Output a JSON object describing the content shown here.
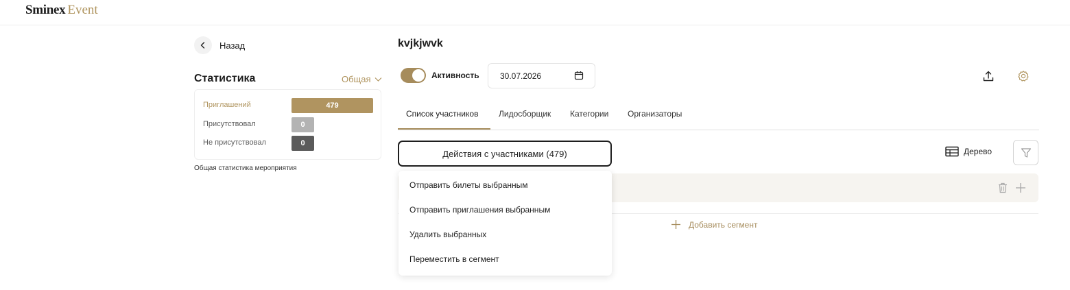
{
  "brand": {
    "name_bold": "Sminex",
    "name_light": "Event"
  },
  "back": {
    "label": "Назад"
  },
  "statistics": {
    "title": "Статистика",
    "filter": "Общая",
    "rows": [
      {
        "label": "Приглашений",
        "value": "479",
        "color": "#b09460"
      },
      {
        "label": "Присутствовал",
        "value": "0",
        "color": "#b3b3b3"
      },
      {
        "label": "Не присутствовал",
        "value": "0",
        "color": "#5b5b5b"
      }
    ],
    "caption": "Общая статистика мероприятия"
  },
  "event": {
    "title": "kvjkjwvk",
    "activity_label": "Активность",
    "activity_on": true,
    "date": "30.07.2026"
  },
  "tabs": [
    {
      "label": "Список участников",
      "active": true
    },
    {
      "label": "Лидосборщик",
      "active": false
    },
    {
      "label": "Категории",
      "active": false
    },
    {
      "label": "Организаторы",
      "active": false
    }
  ],
  "toolbar": {
    "actions_label": "Действия с участниками (479)",
    "tree_label": "Дерево"
  },
  "dropdown": {
    "items": [
      "Отправить билеты выбранным",
      "Отправить приглашения выбранным",
      "Удалить выбранных",
      "Переместить в сегмент"
    ]
  },
  "segments": {
    "add_label": "Добавить сегмент"
  },
  "colors": {
    "accent": "#a68c5c",
    "accent_text": "#b0955f",
    "dark": "#1e1e1e"
  },
  "icons": [
    "chevron-left-icon",
    "chevron-down-icon",
    "calendar-icon",
    "upload-icon",
    "gear-icon",
    "table-icon",
    "filter-icon",
    "trash-icon",
    "plus-icon"
  ]
}
